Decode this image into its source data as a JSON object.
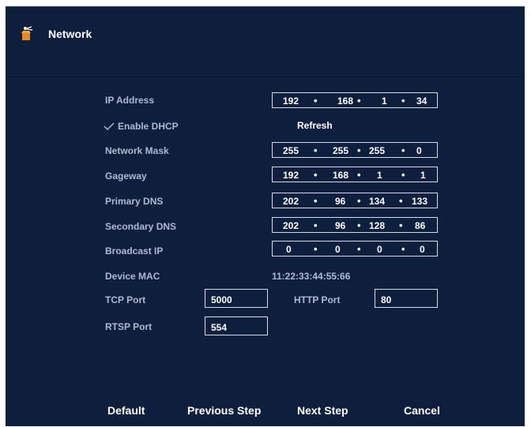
{
  "header": {
    "title": "Network"
  },
  "fields": {
    "ip_address": {
      "label": "IP Address",
      "octets": [
        "192",
        "168",
        "1",
        "34"
      ]
    },
    "enable_dhcp": {
      "label": "Enable DHCP",
      "checked": true
    },
    "refresh_label": "Refresh",
    "network_mask": {
      "label": "Network Mask",
      "octets": [
        "255",
        "255",
        "255",
        "0"
      ]
    },
    "gateway": {
      "label": "Gageway",
      "octets": [
        "192",
        "168",
        "1",
        "1"
      ]
    },
    "primary_dns": {
      "label": "Primary DNS",
      "octets": [
        "202",
        "96",
        "134",
        "133"
      ]
    },
    "secondary_dns": {
      "label": "Secondary DNS",
      "octets": [
        "202",
        "96",
        "128",
        "86"
      ]
    },
    "broadcast_ip": {
      "label": "Broadcast IP",
      "octets": [
        "0",
        "0",
        "0",
        "0"
      ]
    },
    "device_mac": {
      "label": "Device MAC",
      "value": "11:22:33:44:55:66"
    },
    "tcp_port": {
      "label": "TCP Port",
      "value": "5000"
    },
    "http_port": {
      "label": "HTTP Port",
      "value": "80"
    },
    "rtsp_port": {
      "label": "RTSP Port",
      "value": "554"
    }
  },
  "footer": {
    "default_label": "Default",
    "previous_label": "Previous Step",
    "next_label": "Next Step",
    "cancel_label": "Cancel"
  },
  "icons": {
    "title_icon": "network-wizard-icon",
    "check_icon": "checkmark-icon"
  },
  "colors": {
    "panel_bg": "#0e1f3d",
    "label": "#aeb9cf",
    "text": "#ffffff",
    "border": "#d6dbe6"
  }
}
